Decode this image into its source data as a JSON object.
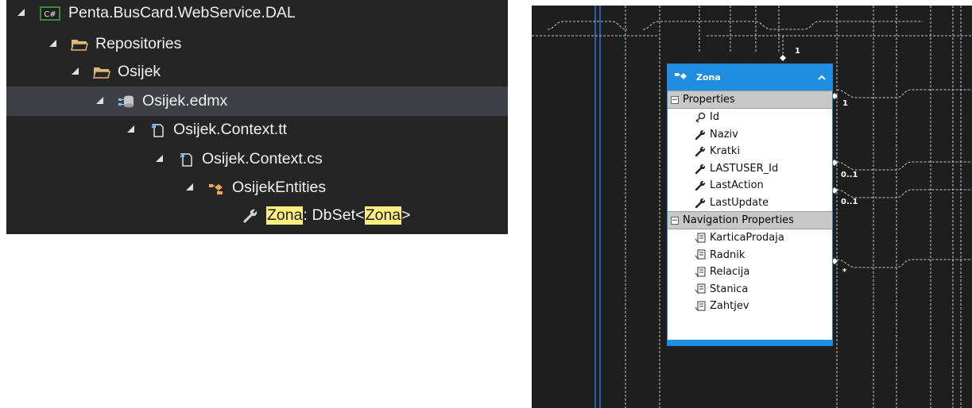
{
  "solution_explorer": {
    "items": [
      {
        "label": "Penta.BusCard.WebService.DAL",
        "icon": "csharp-project-icon"
      },
      {
        "label": "Repositories",
        "icon": "folder-icon"
      },
      {
        "label": "Osijek",
        "icon": "folder-icon"
      },
      {
        "label": "Osijek.edmx",
        "icon": "edmx-icon",
        "selected": true
      },
      {
        "label": "Osijek.Context.tt",
        "icon": "template-file-icon"
      },
      {
        "label": "Osijek.Context.cs",
        "icon": "cs-file-icon"
      },
      {
        "label": "OsijekEntities",
        "icon": "entity-class-icon"
      }
    ],
    "member": {
      "name": "Zona",
      "separator": " : DbSet<",
      "type": "Zona",
      "close": ">",
      "icon": "property-wrench-icon"
    },
    "project_badge": "C#"
  },
  "designer": {
    "entity": {
      "name": "Zona",
      "properties_header": "Properties",
      "properties": [
        {
          "name": "Id",
          "icon": "key-icon"
        },
        {
          "name": "Naziv",
          "icon": "property-wrench-icon"
        },
        {
          "name": "Kratki",
          "icon": "property-wrench-icon"
        },
        {
          "name": "LASTUSER_Id",
          "icon": "property-wrench-icon"
        },
        {
          "name": "LastAction",
          "icon": "property-wrench-icon"
        },
        {
          "name": "LastUpdate",
          "icon": "property-wrench-icon"
        }
      ],
      "navigation_header": "Navigation Properties",
      "navigation": [
        {
          "name": "KarticaProdaja",
          "icon": "navigation-property-icon"
        },
        {
          "name": "Radnik",
          "icon": "navigation-property-icon"
        },
        {
          "name": "Relacija",
          "icon": "navigation-property-icon"
        },
        {
          "name": "Stanica",
          "icon": "navigation-property-icon"
        },
        {
          "name": "Zahtjev",
          "icon": "navigation-property-icon"
        }
      ]
    },
    "multiplicities": [
      "1",
      "1",
      "0..1",
      "0..1",
      "*"
    ]
  }
}
